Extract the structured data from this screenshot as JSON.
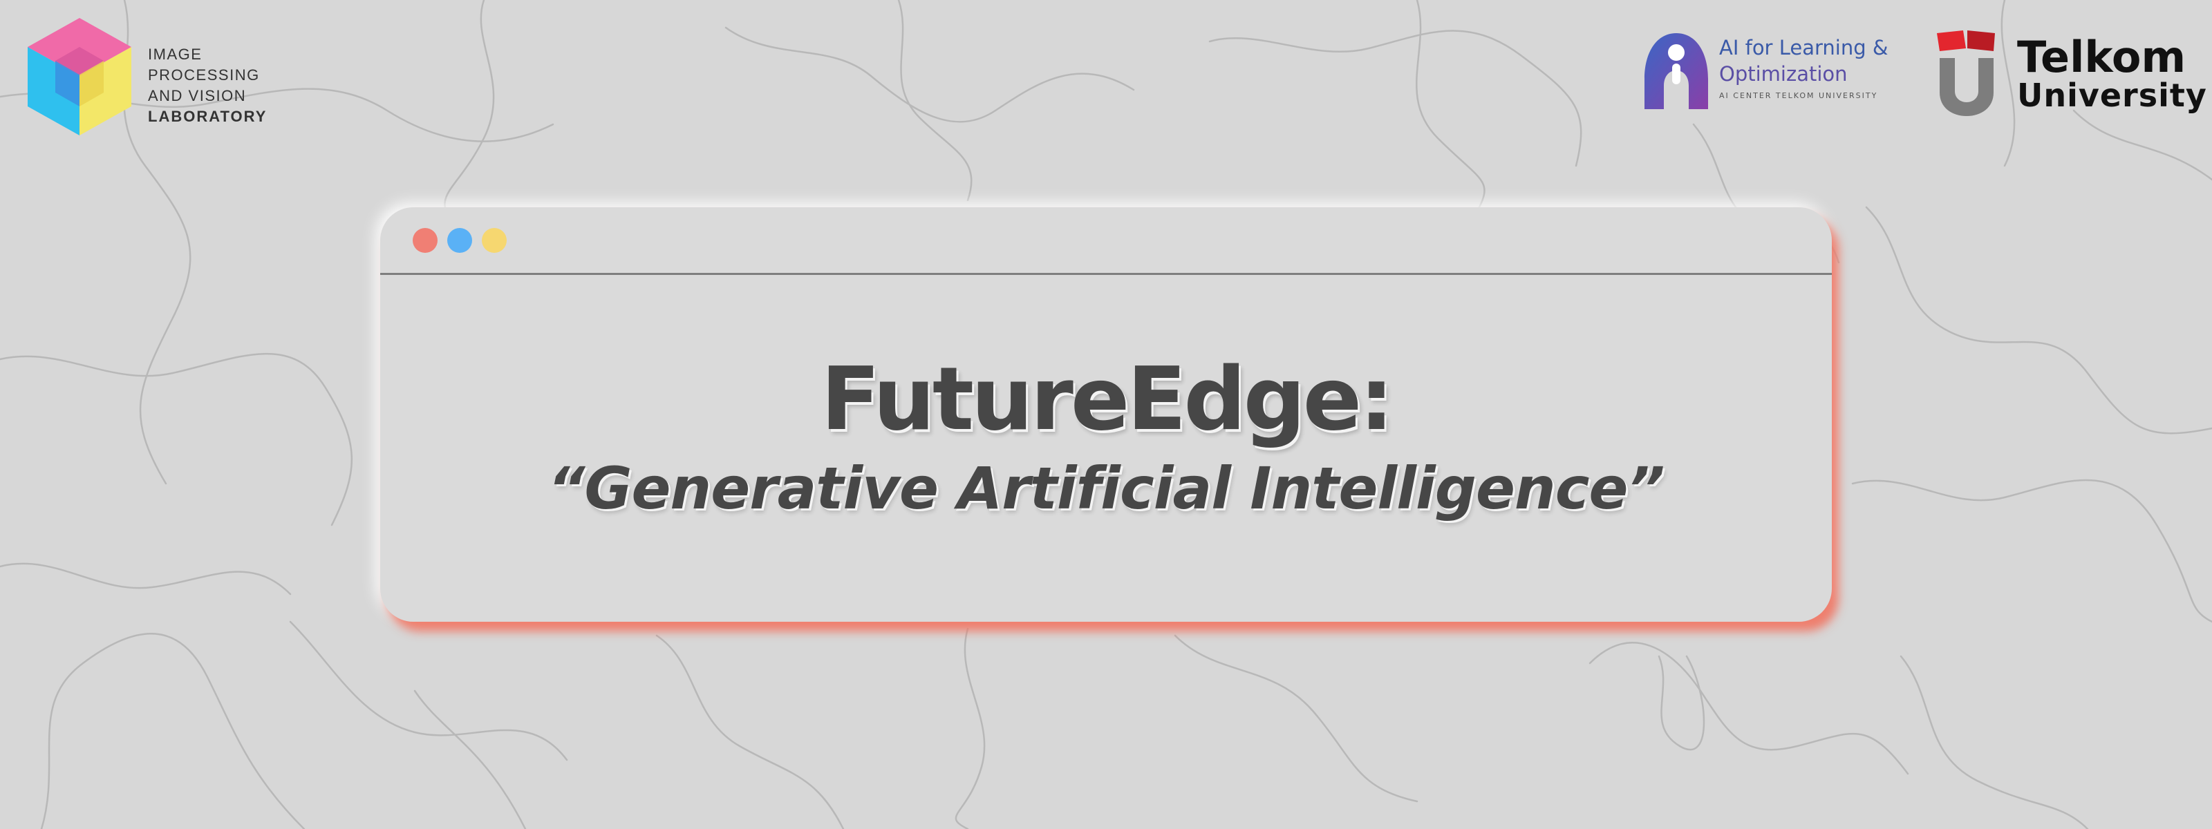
{
  "logos": {
    "lab": {
      "line1": "IMAGE PROCESSING",
      "line2": "AND VISION",
      "line3": "LABORATORY"
    },
    "ai": {
      "line1": "AI for Learning &",
      "line2": "Optimization",
      "line3": "AI CENTER TELKOM UNIVERSITY"
    },
    "telkom": {
      "line1": "Telkom",
      "line2": "University"
    }
  },
  "window": {
    "title": "FutureEdge:",
    "subtitle": "“Generative Artificial Intelligence”",
    "dots": [
      "#f07f74",
      "#5ab1f6",
      "#f6d770"
    ]
  },
  "colors": {
    "background": "#d7d7d7",
    "card": "#dadada",
    "accent_glow": "#f26e5a",
    "text": "#474747"
  }
}
